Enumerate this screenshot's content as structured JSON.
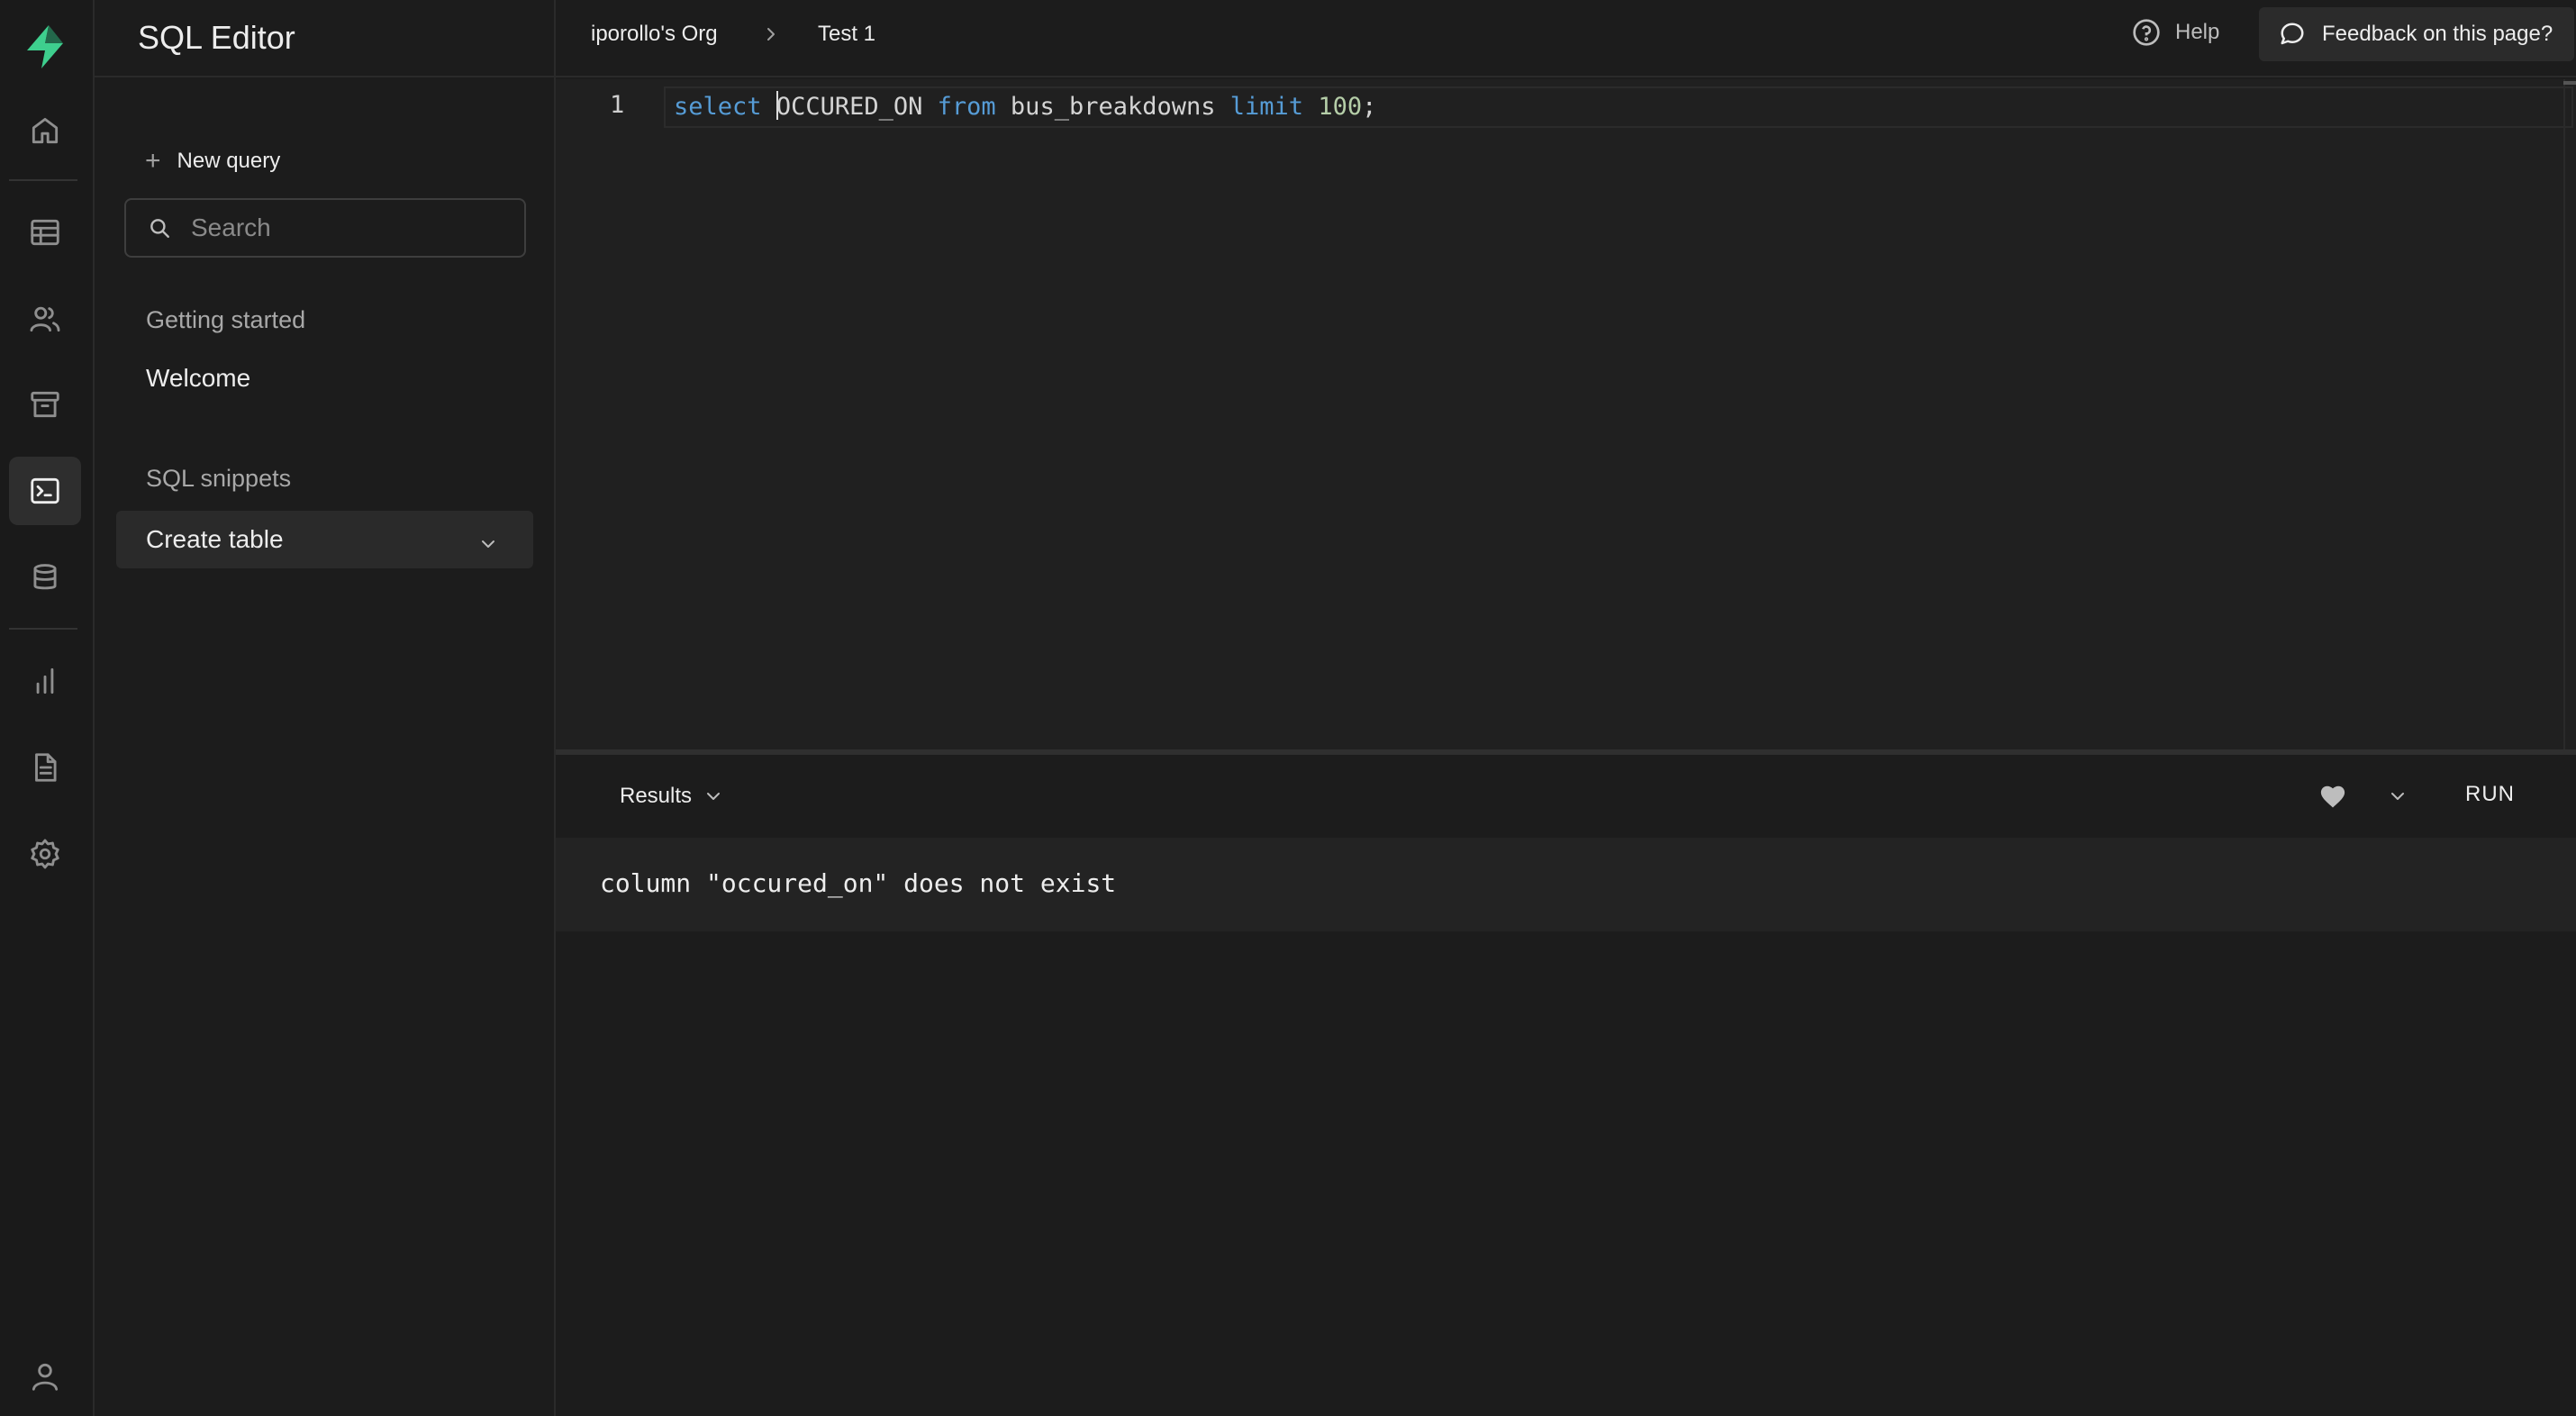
{
  "app": {
    "title": "SQL Editor",
    "accent": "#3ecf8e"
  },
  "rail": {
    "icons": [
      "lightning-logo-icon",
      "home-icon",
      "table-editor-icon",
      "users-icon",
      "storage-icon",
      "sql-editor-icon",
      "database-icon",
      "reports-icon",
      "docs-icon",
      "settings-icon",
      "account-icon"
    ],
    "active": "sql-editor-icon"
  },
  "sidebar": {
    "new_query_label": "New query",
    "search_placeholder": "Search",
    "getting_started_label": "Getting started",
    "getting_started_items": [
      "Welcome"
    ],
    "snippets_label": "SQL snippets",
    "snippets": [
      "Create table"
    ]
  },
  "topbar": {
    "breadcrumb": [
      "iporollo's Org",
      "Test 1"
    ],
    "help_label": "Help",
    "feedback_label": "Feedback on this page?"
  },
  "editor": {
    "line_number": "1",
    "tokens": [
      {
        "text": "select",
        "kind": "keyword"
      },
      {
        "text": " ",
        "kind": "plain"
      },
      {
        "text": "OCCURED_ON",
        "kind": "plain"
      },
      {
        "text": " ",
        "kind": "plain"
      },
      {
        "text": "from",
        "kind": "keyword"
      },
      {
        "text": " bus_breakdowns ",
        "kind": "plain"
      },
      {
        "text": "limit",
        "kind": "keyword"
      },
      {
        "text": " ",
        "kind": "plain"
      },
      {
        "text": "100",
        "kind": "number"
      },
      {
        "text": ";",
        "kind": "plain"
      }
    ]
  },
  "results": {
    "tab_label": "Results",
    "run_label": "RUN",
    "error_message": "column \"occured_on\" does not exist"
  }
}
